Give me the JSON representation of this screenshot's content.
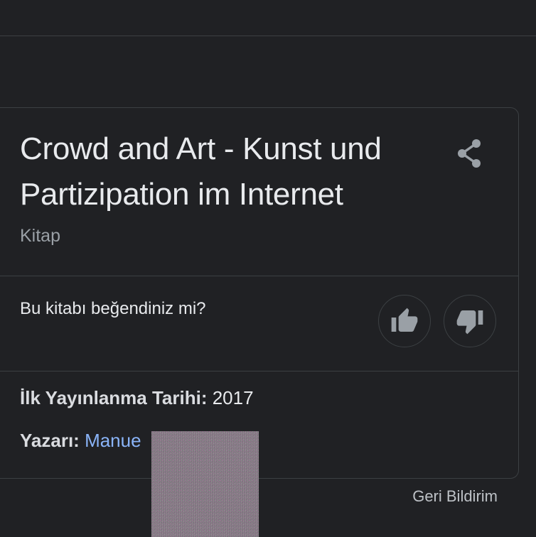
{
  "knowledge_panel": {
    "title": "Crowd and Art - Kunst und Partizipation im Internet",
    "subtitle": "Kitap",
    "share_icon": "share-icon",
    "rating": {
      "question": "Bu kitabı beğendiniz mi?",
      "like_icon": "thumbs-up-icon",
      "dislike_icon": "thumbs-down-icon"
    },
    "facts": {
      "first_published_label": "İlk Yayınlanma Tarihi:",
      "first_published_value": "2017",
      "author_label": "Yazarı:",
      "author_value": "Manue"
    }
  },
  "footer": {
    "feedback_label": "Geri Bildirim"
  },
  "colors": {
    "background": "#202124",
    "border": "#3c4043",
    "text_primary": "#e8eaed",
    "text_secondary": "#9aa0a6",
    "link": "#8ab4f8"
  }
}
